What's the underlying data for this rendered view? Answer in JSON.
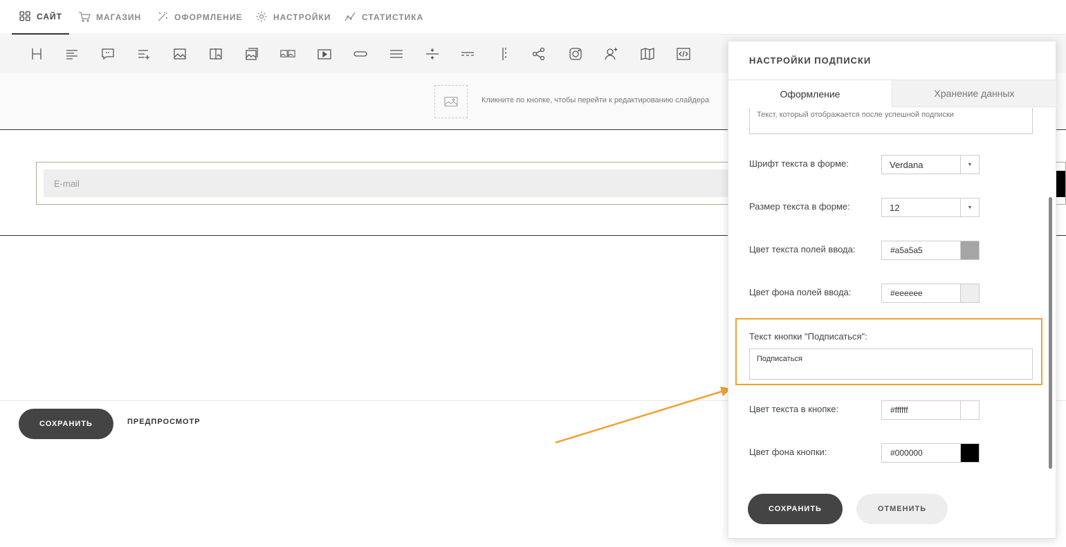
{
  "nav": {
    "items": [
      {
        "label": "САЙТ",
        "icon": "grid-icon"
      },
      {
        "label": "МАГАЗИН",
        "icon": "cart-icon"
      },
      {
        "label": "ОФОРМЛЕНИЕ",
        "icon": "magic-wand-icon"
      },
      {
        "label": "НАСТРОЙКИ",
        "icon": "gear-icon"
      },
      {
        "label": "СТАТИСТИКА",
        "icon": "chart-line-icon"
      }
    ],
    "active_index": 0
  },
  "toolbar": {
    "tools": [
      "heading-icon",
      "text-icon",
      "quote-icon",
      "list-add-icon",
      "image-icon",
      "image-text-icon",
      "gallery-icon",
      "slider-icon",
      "video-icon",
      "button-icon",
      "divider-thick-icon",
      "spacer-icon",
      "dashed-line-icon",
      "vertical-divider-icon",
      "share-icon",
      "instagram-icon",
      "subscribe-user-icon",
      "map-icon",
      "code-icon"
    ]
  },
  "slider": {
    "hint": "Кликните по кнопке, чтобы перейти к редактированию слайдера"
  },
  "form": {
    "email_placeholder": "E-mail"
  },
  "bottom": {
    "save_label": "СОХРАНИТЬ",
    "preview_label": "ПРЕДПРОСМОТР"
  },
  "panel": {
    "title": "НАСТРОЙКИ ПОДПИСКИ",
    "tabs": [
      "Оформление",
      "Хранение данных"
    ],
    "success_text": "Текст, который отображается после успешной подписки",
    "font_label": "Шрифт текста в форме:",
    "font_value": "Verdana",
    "size_label": "Размер текста в форме:",
    "size_value": "12",
    "input_text_color_label": "Цвет текста полей ввода:",
    "input_text_color": "#a5a5a5",
    "input_bg_color_label": "Цвет фона полей ввода:",
    "input_bg_color": "#eeeeee",
    "button_text_label": "Текст кнопки \"Подписаться\":",
    "button_text_value": "Подписаться",
    "button_text_color_label": "Цвет текста в кнопке:",
    "button_text_color": "#ffffff",
    "button_bg_color_label": "Цвет фона кнопки:",
    "button_bg_color": "#000000",
    "save_label": "СОХРАНИТЬ",
    "cancel_label": "ОТМЕНИТЬ"
  },
  "colors": {
    "accent_highlight": "#f0a030",
    "dark_button": "#444444"
  }
}
